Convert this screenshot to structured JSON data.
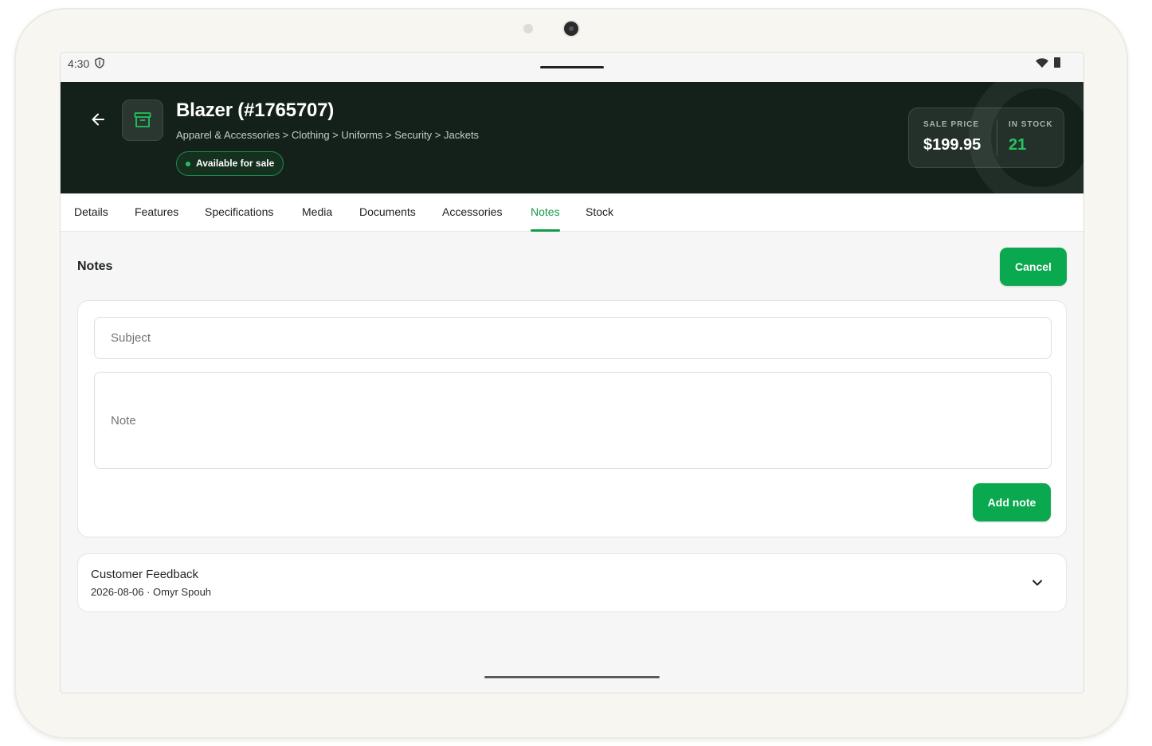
{
  "status_bar": {
    "time": "4:30"
  },
  "product": {
    "title": "Blazer (#1765707)",
    "breadcrumb": "Apparel & Accessories > Clothing > Uniforms > Security > Jackets",
    "availability": "Available for sale",
    "sale_price_label": "SALE PRICE",
    "sale_price": "$199.95",
    "in_stock_label": "IN STOCK",
    "in_stock": "21"
  },
  "tabs": [
    {
      "label": "Details",
      "active": false
    },
    {
      "label": "Features",
      "active": false
    },
    {
      "label": "Specifications",
      "active": false
    },
    {
      "label": "Media",
      "active": false
    },
    {
      "label": "Documents",
      "active": false
    },
    {
      "label": "Accessories",
      "active": false
    },
    {
      "label": "Notes",
      "active": true
    },
    {
      "label": "Stock",
      "active": false
    }
  ],
  "notes_section": {
    "title": "Notes",
    "cancel_label": "Cancel",
    "subject_placeholder": "Subject",
    "note_placeholder": "Note",
    "add_label": "Add note"
  },
  "notes": [
    {
      "subject": "Customer Feedback",
      "meta": "2026-08-06 · Omyr Spouh"
    }
  ],
  "colors": {
    "accent": "#0aa84f",
    "header_bg": "#14211a",
    "stock_value": "#27c25f"
  },
  "icons": [
    "shield-icon",
    "back-arrow-icon",
    "archive-box-icon",
    "wifi-icon",
    "battery-icon",
    "chevron-down-icon"
  ]
}
